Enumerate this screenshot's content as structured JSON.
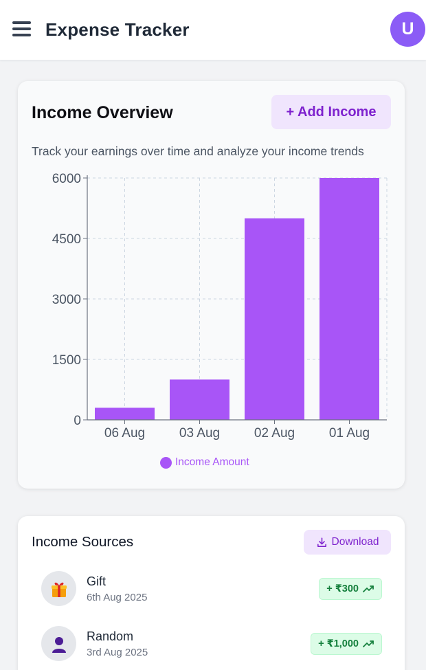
{
  "header": {
    "menu_icon": "hamburger-menu-icon",
    "title": "Expense Tracker",
    "avatar_initial": "U"
  },
  "overview": {
    "title": "Income Overview",
    "add_button": "+ Add Income",
    "subtitle": "Track your earnings over time and analyze your income trends"
  },
  "chart_data": {
    "type": "bar",
    "categories": [
      "06 Aug",
      "03 Aug",
      "02 Aug",
      "01 Aug"
    ],
    "series": [
      {
        "name": "Income Amount",
        "values": [
          300,
          1000,
          5000,
          6000
        ],
        "color": "#a855f7"
      }
    ],
    "y_ticks": [
      "0",
      "1500",
      "3000",
      "4500",
      "6000"
    ],
    "ylim": [
      0,
      6000
    ],
    "grid": true,
    "legend_position": "bottom"
  },
  "sources": {
    "title": "Income Sources",
    "download_label": "Download",
    "items": [
      {
        "name": "Gift",
        "date": "6th Aug 2025",
        "amount": "+ ₹300",
        "icon": "gift-icon"
      },
      {
        "name": "Random",
        "date": "3rd Aug 2025",
        "amount": "+ ₹1,000",
        "icon": "person-icon"
      }
    ]
  },
  "colors": {
    "accent": "#8b5cf6",
    "bar": "#a855f7",
    "positive": "#15803d"
  }
}
